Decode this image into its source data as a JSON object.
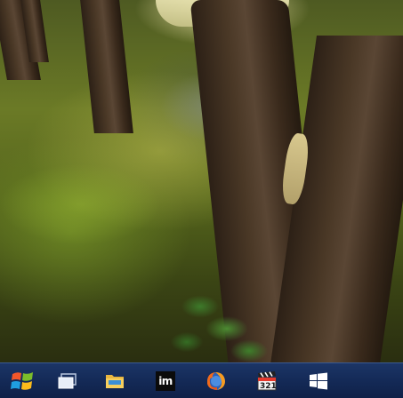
{
  "desktop": {
    "wallpaper": "forest-trees-pond"
  },
  "taskbar": {
    "background_color": "#142a57",
    "items": [
      {
        "name": "start-button",
        "icon": "windows-logo-icon",
        "label": ""
      },
      {
        "name": "task-view-button",
        "icon": "task-view-icon",
        "label": ""
      },
      {
        "name": "file-explorer-button",
        "icon": "folder-icon",
        "label": ""
      },
      {
        "name": "im-app-button",
        "icon": "im-icon",
        "label": "im"
      },
      {
        "name": "firefox-button",
        "icon": "firefox-icon",
        "label": ""
      },
      {
        "name": "media-player-button",
        "icon": "clapperboard-icon",
        "label": "321"
      },
      {
        "name": "store-button",
        "icon": "windows-store-icon",
        "label": ""
      }
    ]
  }
}
